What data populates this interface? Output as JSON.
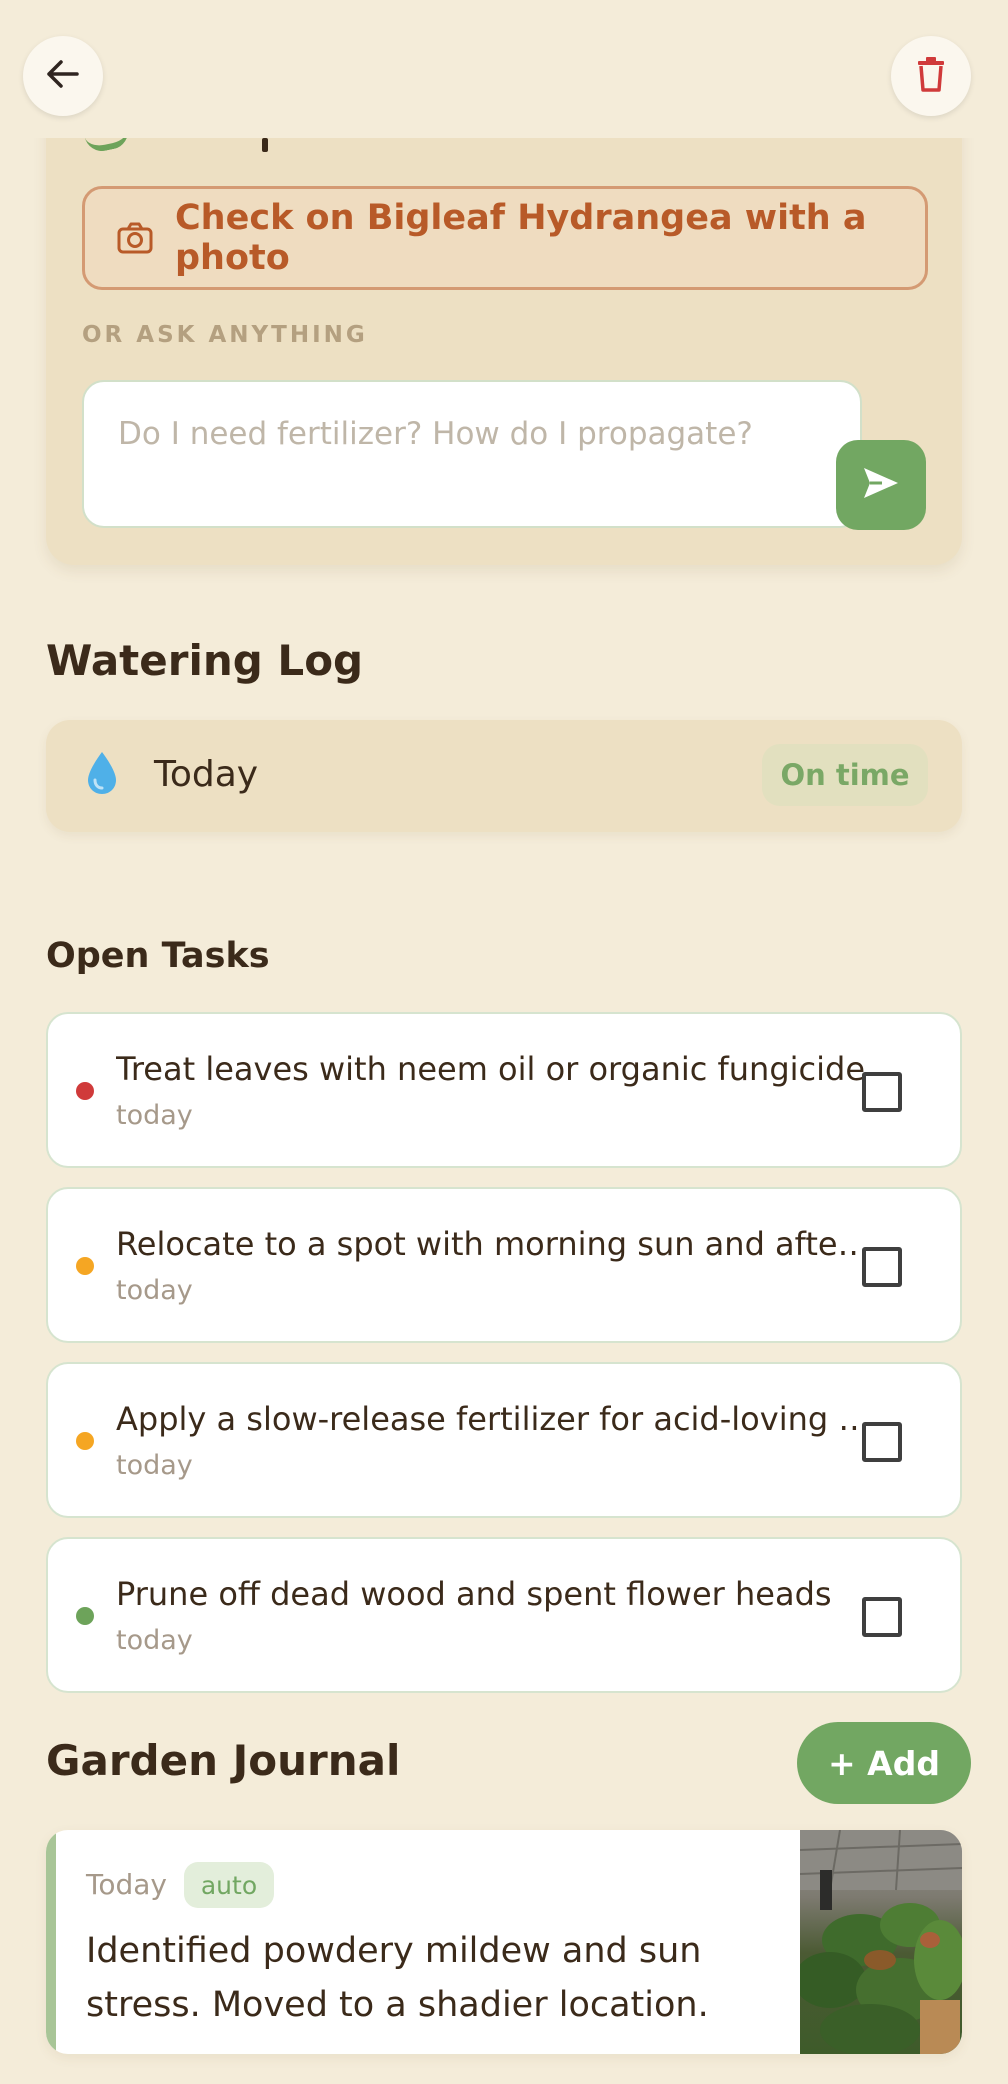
{
  "ask": {
    "photo_button": "Check on Bigleaf Hydrangea with a photo",
    "or_label": "OR ASK ANYTHING",
    "input_placeholder": "Do I need fertilizer? How do I propagate?"
  },
  "watering": {
    "title": "Watering Log",
    "entries": [
      {
        "date": "Today",
        "status": "On time"
      }
    ]
  },
  "tasks": {
    "title": "Open Tasks",
    "items": [
      {
        "label": "Treat leaves with neem oil or organic fungicide",
        "due": "today",
        "priority_color": "#d03a3a"
      },
      {
        "label": "Relocate to a spot with morning sun and afternoon shade",
        "due": "today",
        "priority_color": "#f5a623"
      },
      {
        "label": "Apply a slow-release fertilizer for acid-loving plants",
        "due": "today",
        "priority_color": "#f5a623"
      },
      {
        "label": "Prune off dead wood and spent flower heads",
        "due": "today",
        "priority_color": "#6da35a"
      }
    ]
  },
  "journal": {
    "title": "Garden Journal",
    "add_label": "+ Add",
    "entries": [
      {
        "date": "Today",
        "badge": "auto",
        "text": "Identified powdery mildew and sun stress. Moved to a shadier location."
      }
    ]
  },
  "colors": {
    "background": "#f4ecd9",
    "accent_green": "#72a762",
    "accent_orange": "#b85a28",
    "danger_red": "#d03a3a"
  },
  "icons": [
    "back-arrow-icon",
    "trash-icon",
    "camera-icon",
    "send-icon",
    "water-drop-icon",
    "plant-photo"
  ]
}
